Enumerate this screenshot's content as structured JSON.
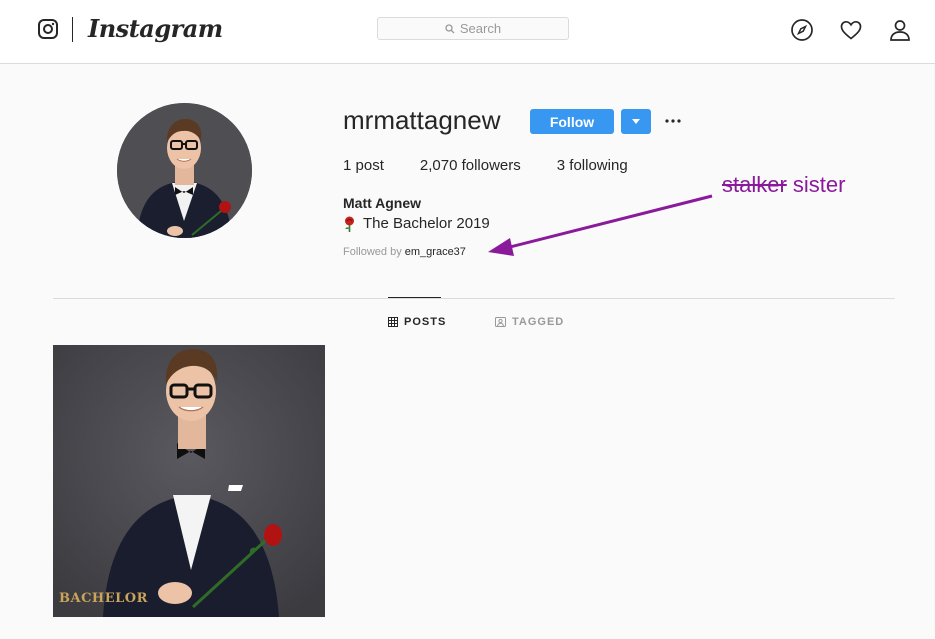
{
  "header": {
    "brand": "Instagram",
    "search_placeholder": "Search"
  },
  "profile": {
    "username": "mrmattagnew",
    "follow_label": "Follow",
    "more_label": "•••",
    "stats": {
      "posts": "1 post",
      "followers": "2,070 followers",
      "following": "3 following"
    },
    "full_name": "Matt Agnew",
    "bio": "The Bachelor 2019",
    "followed_by_prefix": "Followed by ",
    "followed_by_user": "em_grace37"
  },
  "tabs": [
    {
      "label": "POSTS",
      "active": true
    },
    {
      "label": "TAGGED",
      "active": false
    }
  ],
  "posts": [
    {
      "logo_text": "BACHELOR"
    }
  ],
  "annotation": {
    "struck": "stalker",
    "text": "sister",
    "color": "#8a1a9b"
  },
  "colors": {
    "accent": "#3897f0",
    "text": "#262626",
    "muted": "#999999",
    "border": "#dbdbdb"
  }
}
